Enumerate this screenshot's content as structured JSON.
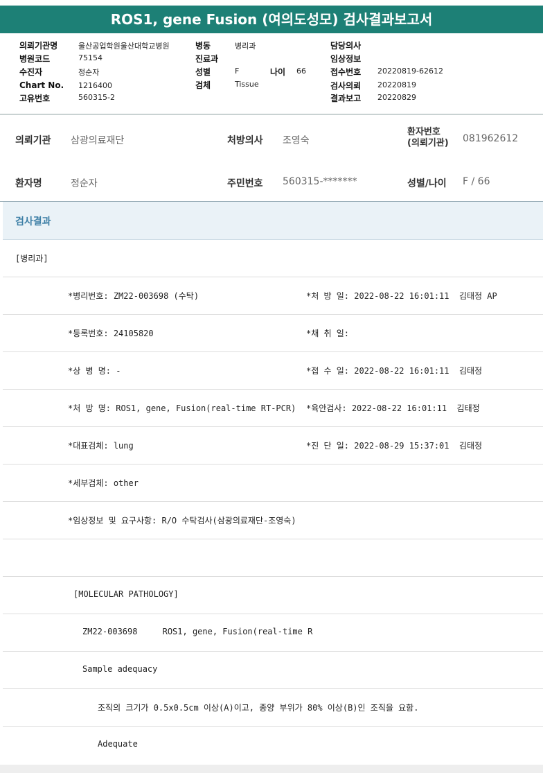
{
  "title": "ROS1, gene Fusion (여의도성모) 검사결과보고서",
  "header_info": {
    "col1": [
      {
        "label": "의뢰기관명",
        "value": "울산공업학원울산대학교병원"
      },
      {
        "label": "병원코드",
        "value": "75154"
      },
      {
        "label": "수진자",
        "value": "정순자"
      },
      {
        "label": "Chart No.",
        "value": "1216400"
      },
      {
        "label": "고유번호",
        "value": "560315-2"
      }
    ],
    "col2": [
      {
        "label": "병동",
        "value": "병리과"
      },
      {
        "label": "진료과",
        "value": ""
      },
      {
        "label": "성별",
        "value": "F"
      },
      {
        "label": "검체",
        "value": "Tissue"
      }
    ],
    "age": {
      "label": "나이",
      "value": "66"
    },
    "col3": [
      {
        "label": "담당의사",
        "value": ""
      },
      {
        "label": "임상정보",
        "value": ""
      },
      {
        "label": "접수번호",
        "value": "20220819-62612"
      },
      {
        "label": "검사의뢰",
        "value": "20220819"
      },
      {
        "label": "결과보고",
        "value": "20220829"
      }
    ]
  },
  "patient": {
    "institution_label": "의뢰기관",
    "institution": "삼광의료재단",
    "doctor_label": "처방의사",
    "doctor": "조영숙",
    "patient_no_label_1": "환자번호",
    "patient_no_label_2": "(의뢰기관)",
    "patient_no": "081962612",
    "name_label": "환자명",
    "name": "정순자",
    "rrn_label": "주민번호",
    "rrn": "560315-*******",
    "sexage_label": "성별/나이",
    "sexage": "F / 66"
  },
  "results_header": "검사결과",
  "rows": [
    {
      "left": "[병리과]",
      "right": ""
    },
    {
      "left": "*병리번호: ZM22-003698 (수탁)",
      "right": "*처 방 일: 2022-08-22 16:01:11  김태정 AP"
    },
    {
      "left": "*등록번호: 24105820",
      "right": "*채 취 일:"
    },
    {
      "left": "*상 병 명: -",
      "right": "*접 수 일: 2022-08-22 16:01:11  김태정"
    },
    {
      "left": "*처 방 명: ROS1, gene, Fusion(real-time RT-PCR)",
      "right": "*육안검사: 2022-08-22 16:01:11  김태정"
    },
    {
      "left": "*대표검체: lung",
      "right": "*진 단 일: 2022-08-29 15:37:01  김태정"
    },
    {
      "left": "*세부검체: other",
      "right": ""
    },
    {
      "left": "*임상정보 및 요구사항: R/O 수탁검사(삼광의료재단-조영숙)",
      "right": ""
    },
    {
      "left": "",
      "right": ""
    },
    {
      "left": "[MOLECULAR PATHOLOGY]",
      "right": ""
    },
    {
      "left": "ZM22-003698     ROS1, gene, Fusion(real-time R",
      "right": ""
    },
    {
      "left": "Sample adequacy",
      "right": ""
    },
    {
      "left": "조직의 크기가 0.5x0.5cm 이상(A)이고, 종양 부위가 80% 이상(B)인 조직을 요함.",
      "right": ""
    },
    {
      "left": "Adequate",
      "right": ""
    }
  ]
}
